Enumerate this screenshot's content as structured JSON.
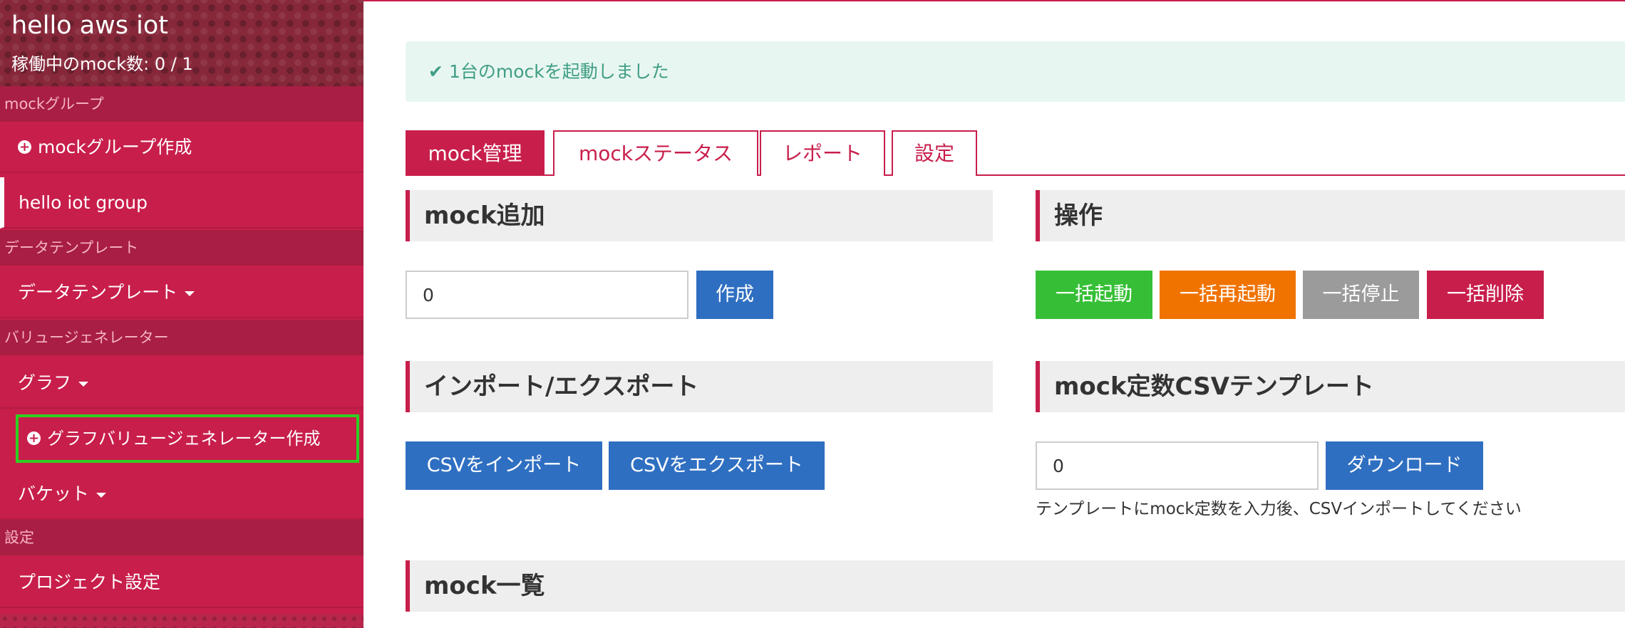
{
  "sidebar": {
    "app_title": "hello aws iot",
    "mock_count": "稼働中のmock数: 0 / 1",
    "sections": {
      "mock_group": "mockグループ",
      "data_template": "データテンプレート",
      "value_generator": "バリュージェネレーター",
      "settings": "設定"
    },
    "items": {
      "create_mock_group": "mockグループ作成",
      "hello_iot_group": "hello iot group",
      "data_template": "データテンプレート",
      "graph": "グラフ",
      "create_graph_value_generator": "グラフバリュージェネレーター作成",
      "bucket": "バケット",
      "project_settings": "プロジェクト設定"
    }
  },
  "alert": {
    "message": "1台のmockを起動しました"
  },
  "tabs": [
    {
      "label": "mock管理",
      "active": true
    },
    {
      "label": "mockステータス",
      "active": false
    },
    {
      "label": "レポート",
      "active": false
    },
    {
      "label": "設定",
      "active": false
    }
  ],
  "mock_add": {
    "title": "mock追加",
    "input_value": "0",
    "create_button": "作成"
  },
  "operations": {
    "title": "操作",
    "buttons": [
      "一括起動",
      "一括再起動",
      "一括停止",
      "一括削除"
    ]
  },
  "import_export": {
    "title": "インポート/エクスポート",
    "import_button": "CSVをインポート",
    "export_button": "CSVをエクスポート"
  },
  "csv_template": {
    "title": "mock定数CSVテンプレート",
    "input_value": "0",
    "download_button": "ダウンロード",
    "hint": "テンプレートにmock定数を入力後、CSVインポートしてください"
  },
  "mock_list": {
    "title": "mock一覧"
  },
  "colors": {
    "brand": "#c81e4b",
    "primary": "#2f6fc1",
    "success": "#36bf36",
    "warning": "#f07300",
    "neutral": "#9b9b9b",
    "highlight": "#2fcf22"
  }
}
